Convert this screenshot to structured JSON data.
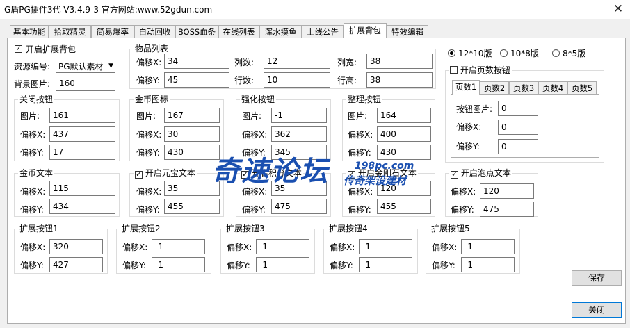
{
  "window": {
    "title": "G盾PG插件3代 V3.4.9-3   官方网站:www.52gdun.com",
    "close_glyph": "✕"
  },
  "tabs": [
    "基本功能",
    "拾取精灵",
    "简易爆率",
    "自动回收",
    "BOSS血条",
    "在线列表",
    "浑水摸鱼",
    "上线公告",
    "扩展背包",
    "特效编辑"
  ],
  "active_tab": "扩展背包",
  "enable_bag": {
    "label": "开启扩展背包",
    "checked": true
  },
  "resource": {
    "label": "资源编号:",
    "value": "PG默认素材"
  },
  "bg_image": {
    "label": "背景图片:",
    "value": "160"
  },
  "items": {
    "title": "物品列表",
    "offset_x": {
      "label": "偏移X:",
      "value": "34"
    },
    "offset_y": {
      "label": "偏移Y:",
      "value": "45"
    },
    "cols": {
      "label": "列数:",
      "value": "12"
    },
    "rows": {
      "label": "行数:",
      "value": "10"
    },
    "col_w": {
      "label": "列宽:",
      "value": "38"
    },
    "row_h": {
      "label": "行高:",
      "value": "38"
    }
  },
  "layout_radios": [
    {
      "label": "12*10版",
      "checked": true
    },
    {
      "label": "10*8版",
      "checked": false
    },
    {
      "label": "8*5版",
      "checked": false
    }
  ],
  "page_btn": {
    "enable_label": "开启页数按钮",
    "checked": false,
    "tabs": [
      "页数1",
      "页数2",
      "页数3",
      "页数4",
      "页数5"
    ],
    "img": {
      "label": "按钮图片:",
      "value": "0"
    },
    "x": {
      "label": "偏移X:",
      "value": "0"
    },
    "y": {
      "label": "偏移Y:",
      "value": "0"
    }
  },
  "close_btn_group": {
    "title": "关闭按钮",
    "img": {
      "label": "图片:",
      "value": "161"
    },
    "x": {
      "label": "偏移X:",
      "value": "437"
    },
    "y": {
      "label": "偏移Y:",
      "value": "17"
    }
  },
  "gold_icon": {
    "title": "金币图标",
    "img": {
      "label": "图片:",
      "value": "167"
    },
    "x": {
      "label": "偏移X:",
      "value": "30"
    },
    "y": {
      "label": "偏移Y:",
      "value": "430"
    }
  },
  "enhance_btn": {
    "title": "强化按钮",
    "img": {
      "label": "图片:",
      "value": "-1"
    },
    "x": {
      "label": "偏移X:",
      "value": "362"
    },
    "y": {
      "label": "偏移Y:",
      "value": "345"
    }
  },
  "sort_btn": {
    "title": "整理按钮",
    "img": {
      "label": "图片:",
      "value": "164"
    },
    "x": {
      "label": "偏移X:",
      "value": "400"
    },
    "y": {
      "label": "偏移Y:",
      "value": "430"
    }
  },
  "gold_text": {
    "title": "金币文本",
    "x": {
      "label": "偏移X:",
      "value": "115"
    },
    "y": {
      "label": "偏移Y:",
      "value": "434"
    }
  },
  "yuanbao_text": {
    "title": "开启元宝文本",
    "checked": true,
    "x": {
      "label": "偏移X:",
      "value": "35"
    },
    "y": {
      "label": "偏移Y:",
      "value": "455"
    }
  },
  "third_text": {
    "title": "开启积分文本",
    "checked": true,
    "x": {
      "label": "偏移X:",
      "value": "35"
    },
    "y": {
      "label": "偏移Y:",
      "value": "475"
    }
  },
  "diamond_text": {
    "title": "开启金刚石文本",
    "checked": true,
    "x": {
      "label": "偏移X:",
      "value": "120"
    },
    "y": {
      "label": "偏移Y:",
      "value": "455"
    }
  },
  "bubble_text": {
    "title": "开启泡点文本",
    "checked": true,
    "x": {
      "label": "偏移X:",
      "value": "120"
    },
    "y": {
      "label": "偏移Y:",
      "value": "475"
    }
  },
  "ext1": {
    "title": "扩展按钮1",
    "x": {
      "label": "偏移X:",
      "value": "320"
    },
    "y": {
      "label": "偏移Y:",
      "value": "427"
    }
  },
  "ext2": {
    "title": "扩展按钮2",
    "x": {
      "label": "偏移X:",
      "value": "-1"
    },
    "y": {
      "label": "偏移Y:",
      "value": "-1"
    }
  },
  "ext3": {
    "title": "扩展按钮3",
    "x": {
      "label": "偏移X:",
      "value": "-1"
    },
    "y": {
      "label": "偏移Y:",
      "value": "-1"
    }
  },
  "ext4": {
    "title": "扩展按钮4",
    "x": {
      "label": "偏移X:",
      "value": "-1"
    },
    "y": {
      "label": "偏移Y:",
      "value": "-1"
    }
  },
  "ext5": {
    "title": "扩展按钮5",
    "x": {
      "label": "偏移X:",
      "value": "-1"
    },
    "y": {
      "label": "偏移Y:",
      "value": "-1"
    }
  },
  "buttons": {
    "save": "保存",
    "close": "关闭"
  },
  "watermark": {
    "main": "奇速论坛",
    "url": "198pc.com",
    "sub": "传奇架设建材"
  }
}
